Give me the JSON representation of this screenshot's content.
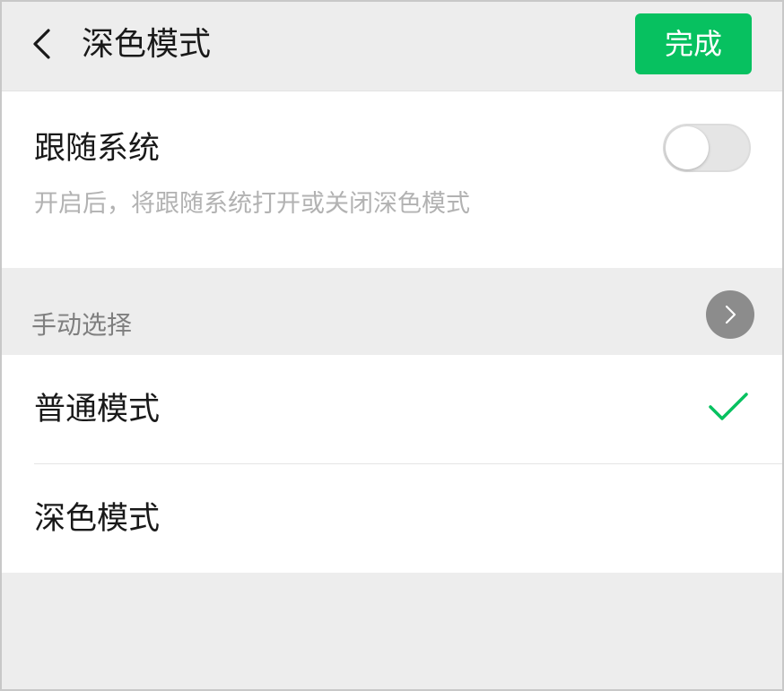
{
  "nav": {
    "back_icon": "chevron-left-icon",
    "title": "深色模式",
    "done_label": "完成"
  },
  "follow_system": {
    "label": "跟随系统",
    "description": "开启后，将跟随系统打开或关闭深色模式",
    "enabled": false
  },
  "manual": {
    "section_label": "手动选择",
    "arrow_icon": "chevron-right-icon",
    "options": [
      {
        "label": "普通模式",
        "selected": true
      },
      {
        "label": "深色模式",
        "selected": false
      }
    ]
  },
  "colors": {
    "accent": "#07c160",
    "background": "#ededed",
    "card": "#ffffff",
    "text_primary": "#191919",
    "text_secondary": "#b2b2b2"
  }
}
